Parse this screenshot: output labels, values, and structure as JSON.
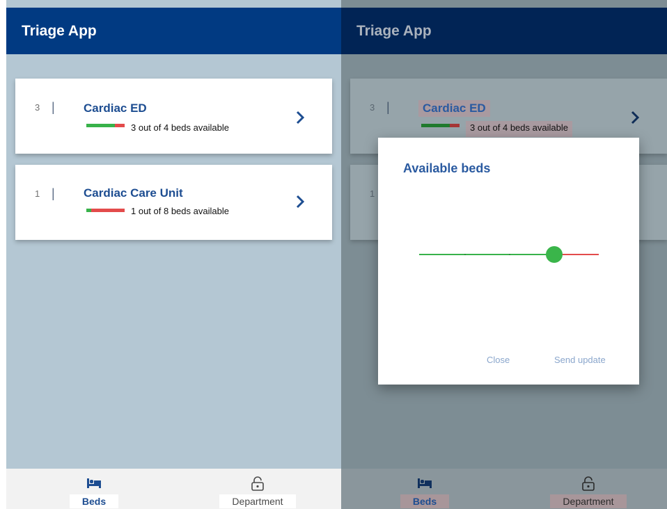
{
  "app": {
    "title": "Triage App"
  },
  "departments": [
    {
      "count": "3",
      "name": "Cardiac ED",
      "availability": "3 out of 4 beds available",
      "available": 3,
      "total": 4
    },
    {
      "count": "1",
      "name": "Cardiac Care Unit",
      "availability": "1 out of 8 beds available",
      "available": 1,
      "total": 8
    }
  ],
  "nav": {
    "items": [
      {
        "label": "Beds",
        "icon": "bed-icon",
        "active": true
      },
      {
        "label": "Department",
        "icon": "lock-icon",
        "active": false
      }
    ]
  },
  "dialog": {
    "title": "Available beds",
    "slider": {
      "value": 3,
      "max": 4
    },
    "close_label": "Close",
    "send_label": "Send update"
  },
  "colors": {
    "app_bar": "#013a82",
    "accent_text": "#1d4d91",
    "available": "#38b24a",
    "occupied": "#e34b4b"
  }
}
